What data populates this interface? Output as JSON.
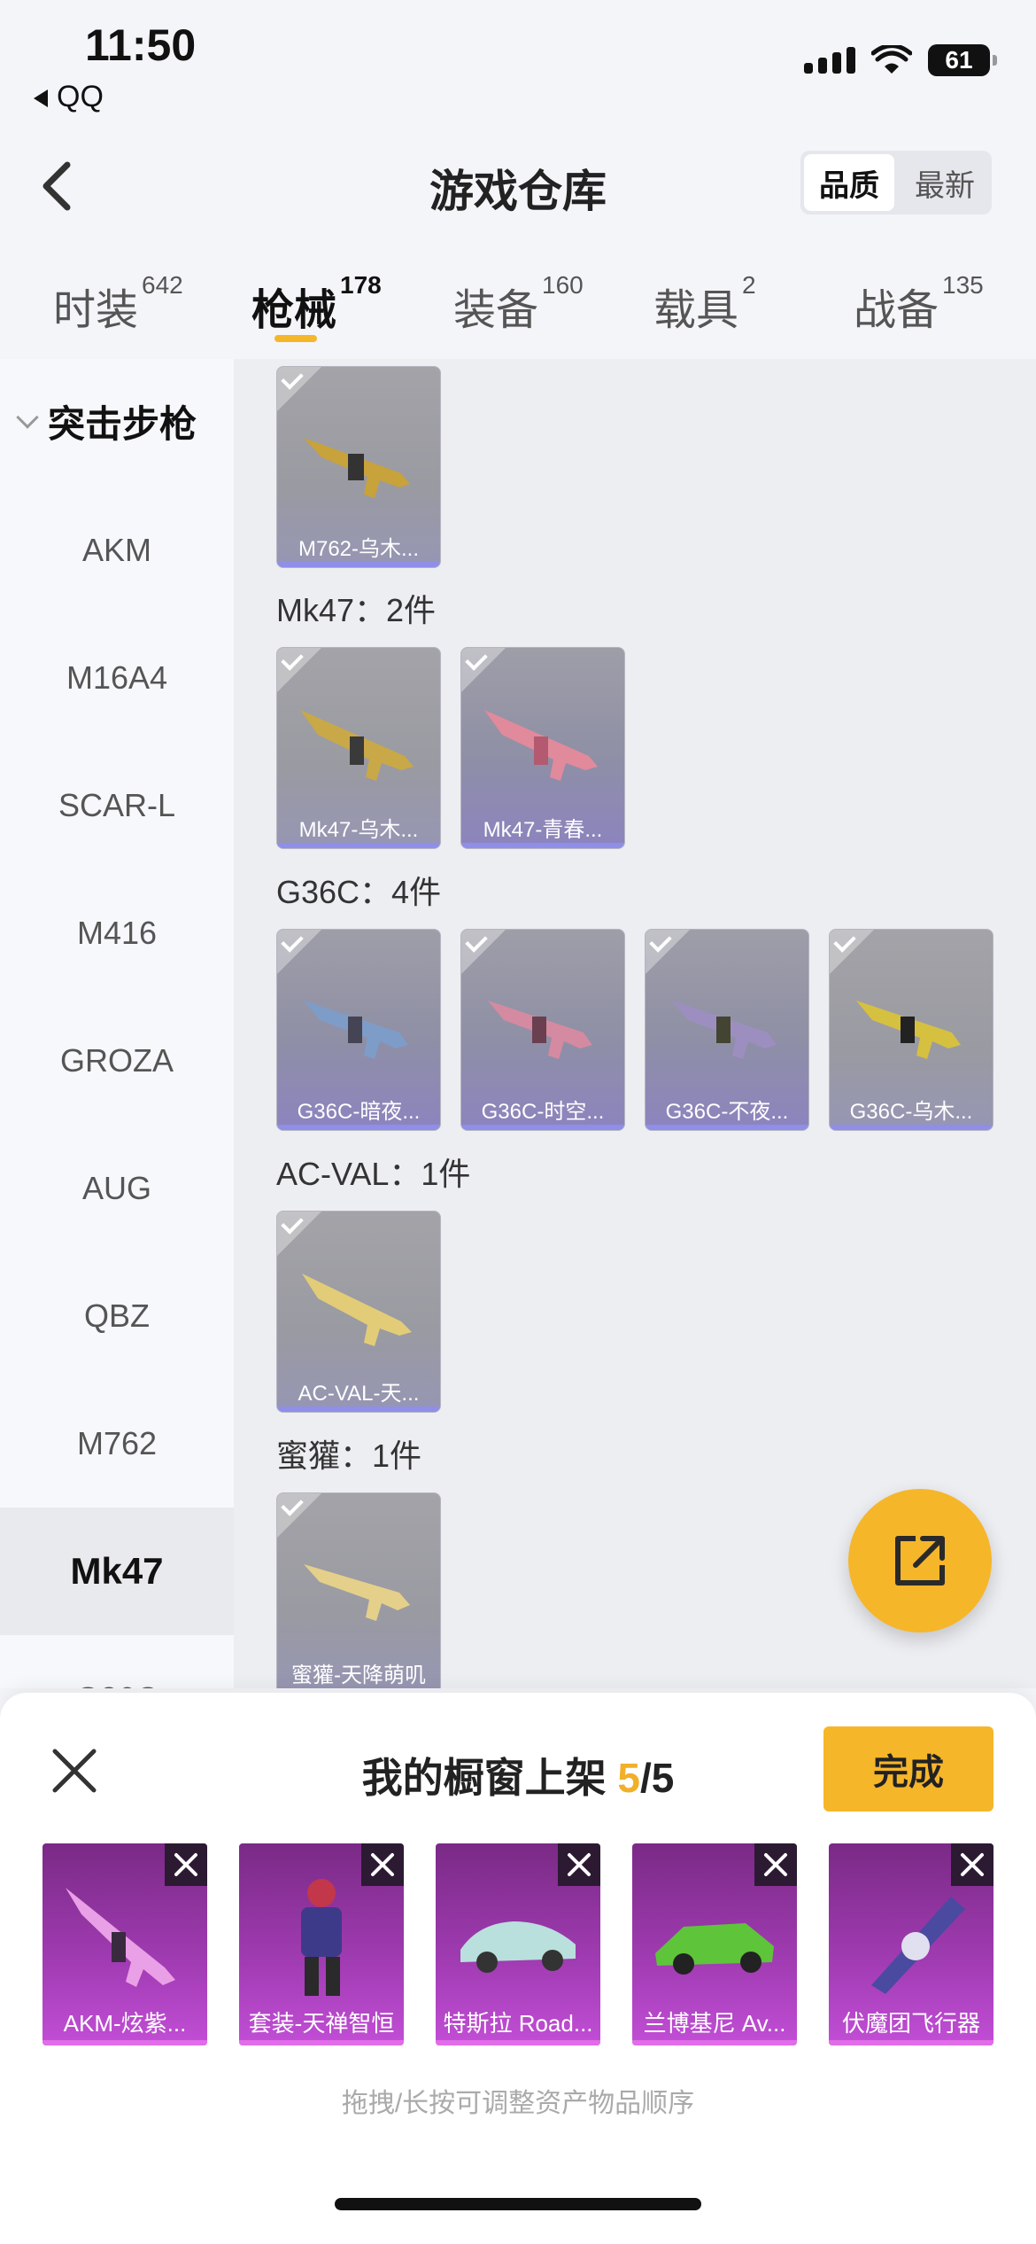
{
  "status": {
    "time": "11:50",
    "back_app": "QQ",
    "battery": "61"
  },
  "header": {
    "title": "游戏仓库",
    "sort_quality": "品质",
    "sort_newest": "最新"
  },
  "tabs": [
    {
      "label": "时装",
      "count": "642"
    },
    {
      "label": "枪械",
      "count": "178"
    },
    {
      "label": "装备",
      "count": "160"
    },
    {
      "label": "载具",
      "count": "2"
    },
    {
      "label": "战备",
      "count": "135"
    }
  ],
  "sidebar": {
    "group": "突击步枪",
    "items": [
      "AKM",
      "M16A4",
      "SCAR-L",
      "M416",
      "GROZA",
      "AUG",
      "QBZ",
      "M762",
      "Mk47",
      "G36C"
    ]
  },
  "main": {
    "top_card": "M762-乌木...",
    "groups": [
      {
        "label": "Mk47：2件",
        "items": [
          "Mk47-乌木...",
          "Mk47-青春..."
        ]
      },
      {
        "label": "G36C：4件",
        "items": [
          "G36C-暗夜...",
          "G36C-时空...",
          "G36C-不夜...",
          "G36C-乌木..."
        ]
      },
      {
        "label": "AC-VAL：1件",
        "items": [
          "AC-VAL-天..."
        ]
      },
      {
        "label": "蜜獾：1件",
        "items": [
          "蜜獾-天降萌叽"
        ]
      }
    ]
  },
  "panel": {
    "title": "我的橱窗上架",
    "count": "5",
    "total": "/5",
    "done": "完成",
    "items": [
      "AKM-炫紫...",
      "套装-天禅智恒",
      "特斯拉 Road...",
      "兰博基尼 Av...",
      "伏魔团飞行器"
    ],
    "hint": "拖拽/长按可调整资产物品顺序"
  },
  "colors": {
    "accent": "#f6b62a",
    "purple_card": "#a23cb4"
  }
}
